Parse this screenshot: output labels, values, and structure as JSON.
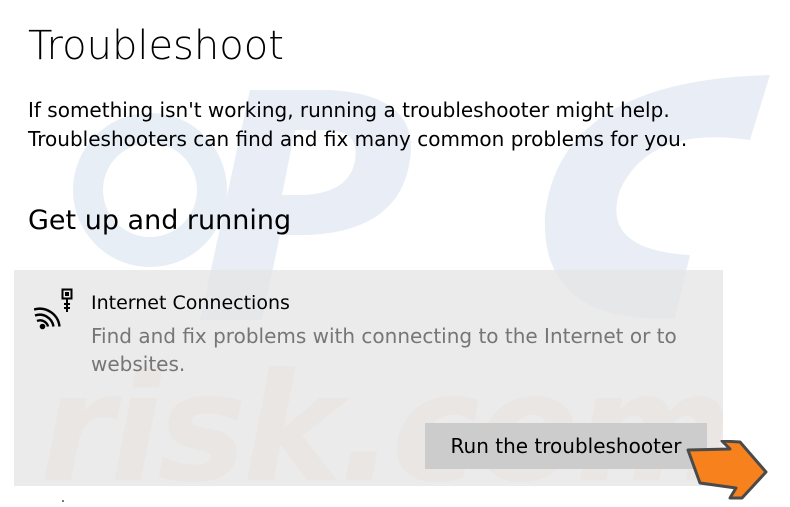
{
  "page": {
    "title": "Troubleshoot",
    "intro_lines": [
      "If something isn't working, running a troubleshooter might help.",
      "Troubleshooters can find and fix many common problems for you."
    ],
    "section_heading": "Get up and running"
  },
  "troubleshooter": {
    "name": "Internet Connections",
    "description": "Find and fix problems with connecting to the Internet or to websites.",
    "icon": "internet-connection-icon",
    "run_button_label": "Run the troubleshooter",
    "highlight_arrow_color": "#f7821d"
  },
  "watermark": {
    "text": "PCrisk.com",
    "colors": [
      "#e9eef6",
      "#fbe9dc"
    ]
  },
  "colors": {
    "panel_background": "#e6e6e6",
    "button_background": "#cccccc",
    "secondary_text": "#767676"
  }
}
